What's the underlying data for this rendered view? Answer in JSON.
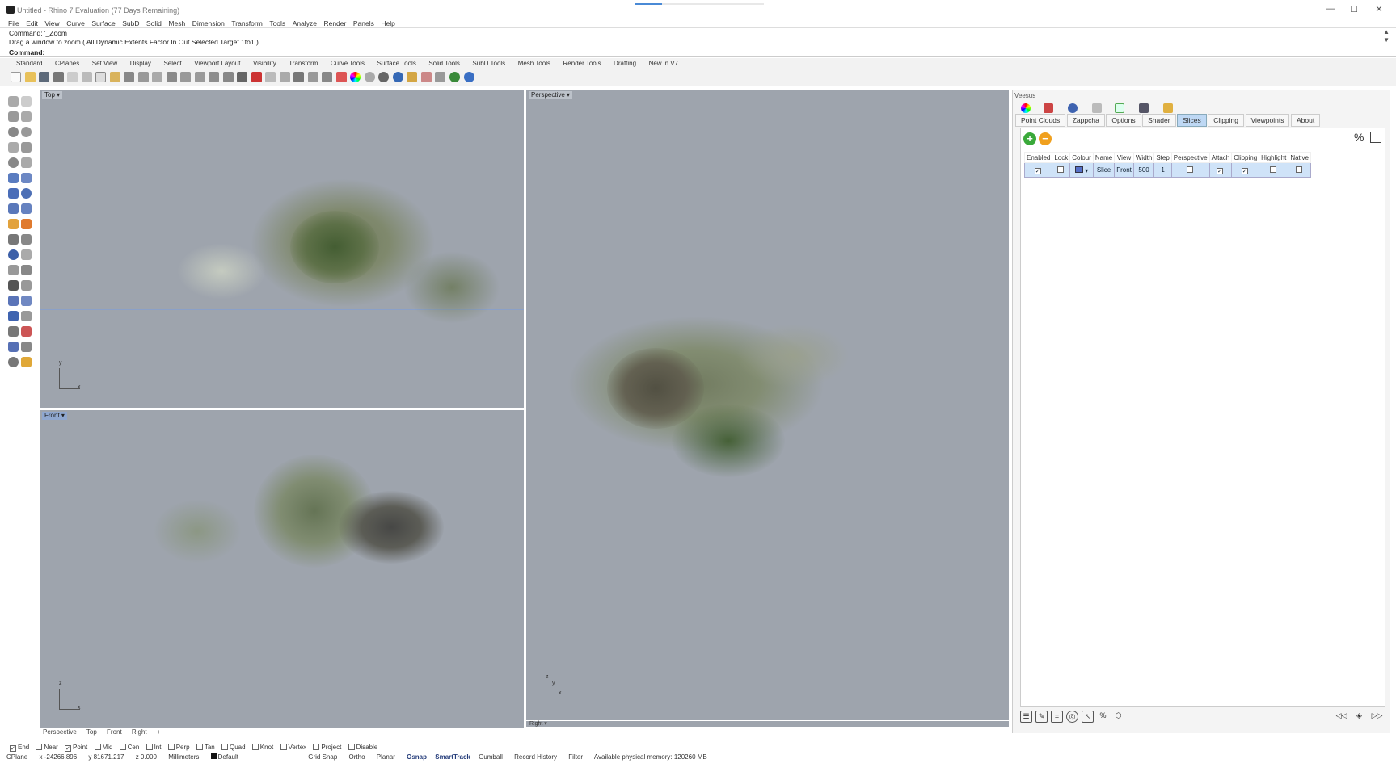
{
  "titlebar": {
    "title": "Untitled - Rhino 7 Evaluation (77 Days Remaining)",
    "minimize": "—",
    "maximize": "☐",
    "close": "✕"
  },
  "menu": [
    "File",
    "Edit",
    "View",
    "Curve",
    "Surface",
    "SubD",
    "Solid",
    "Mesh",
    "Dimension",
    "Transform",
    "Tools",
    "Analyze",
    "Render",
    "Panels",
    "Help"
  ],
  "command": {
    "line1": "Command: '_Zoom",
    "line2": "Drag a window to zoom ( All  Dynamic  Extents  Factor  In  Out  Selected  Target  1to1 )",
    "prompt": "Command:"
  },
  "toolbar_tabs": [
    "Standard",
    "CPlanes",
    "Set View",
    "Display",
    "Select",
    "Viewport Layout",
    "Visibility",
    "Transform",
    "Curve Tools",
    "Surface Tools",
    "Solid Tools",
    "SubD Tools",
    "Mesh Tools",
    "Render Tools",
    "Drafting",
    "New in V7"
  ],
  "viewports": {
    "top": {
      "label": "Top",
      "ax_x": "x",
      "ax_y": "y"
    },
    "front": {
      "label": "Front",
      "ax_x": "x",
      "ax_y": "z"
    },
    "perspective": {
      "label": "Perspective",
      "ax_x": "x",
      "ax_y": "y",
      "ax_z": "z"
    },
    "right_hidden": {
      "label": "Right"
    }
  },
  "viewport_tabs": [
    "Perspective",
    "Top",
    "Front",
    "Right",
    "+"
  ],
  "osnap": [
    {
      "label": "End",
      "checked": true
    },
    {
      "label": "Near",
      "checked": false
    },
    {
      "label": "Point",
      "checked": true
    },
    {
      "label": "Mid",
      "checked": false
    },
    {
      "label": "Cen",
      "checked": false
    },
    {
      "label": "Int",
      "checked": false
    },
    {
      "label": "Perp",
      "checked": false
    },
    {
      "label": "Tan",
      "checked": false
    },
    {
      "label": "Quad",
      "checked": false
    },
    {
      "label": "Knot",
      "checked": false
    },
    {
      "label": "Vertex",
      "checked": false
    },
    {
      "label": "Project",
      "checked": false
    },
    {
      "label": "Disable",
      "checked": false
    }
  ],
  "status": {
    "cplane": "CPlane",
    "x": "x -24266.896",
    "y": "y 81671.217",
    "z": "z 0.000",
    "units": "Millimeters",
    "layer": "Default",
    "grid_snap": "Grid Snap",
    "ortho": "Ortho",
    "planar": "Planar",
    "osnap": "Osnap",
    "smarttrack": "SmartTrack",
    "gumball": "Gumball",
    "record_history": "Record History",
    "filter": "Filter",
    "memory": "Available physical memory: 120260 MB"
  },
  "panel": {
    "title": "Veesus",
    "tabs": [
      "Point Clouds",
      "Zappcha",
      "Options",
      "Shader",
      "Slices",
      "Clipping",
      "Viewpoints",
      "About"
    ],
    "selected_tab": "Slices",
    "table_headers": [
      "Enabled",
      "Lock",
      "Colour",
      "Name",
      "View",
      "Width",
      "Step",
      "Perspective",
      "Attach",
      "Clipping",
      "Highlight",
      "Native"
    ],
    "row": {
      "enabled": "✓",
      "lock": "",
      "colour": "",
      "name": "Slice",
      "view": "Front",
      "width": "500",
      "step": "1",
      "perspective": "",
      "attach": "✓",
      "clipping": "✓",
      "highlight": "",
      "native": ""
    }
  },
  "colors": {
    "viewport_bg": "#9ea4ad",
    "tab_selected": "#bed8f4",
    "add_green": "#3aa93a",
    "remove_orange": "#f0a01e"
  }
}
